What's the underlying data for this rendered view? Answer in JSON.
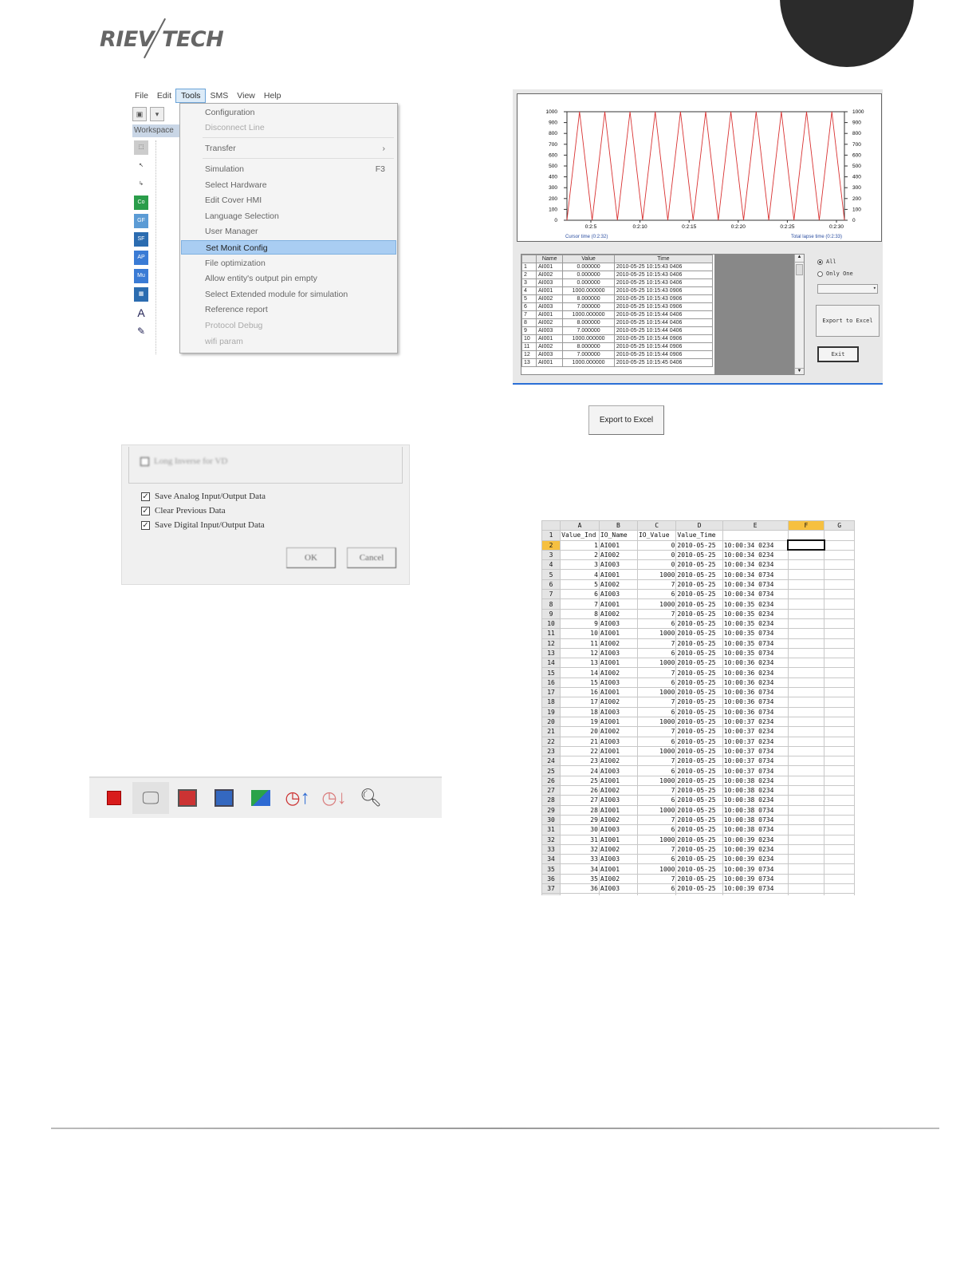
{
  "header": {
    "logo_left": "RIEV",
    "logo_right": "TECH"
  },
  "tools_menu": {
    "menubar": [
      "File",
      "Edit",
      "Tools",
      "SMS",
      "View",
      "Help"
    ],
    "active_menu": "Tools",
    "workspace_label": "Workspace",
    "items": [
      {
        "label": "Configuration",
        "state": "normal"
      },
      {
        "label": "Disconnect Line",
        "state": "disabled"
      },
      {
        "label": "Transfer",
        "state": "normal",
        "shortcut": "›"
      },
      {
        "label": "Simulation",
        "state": "normal",
        "shortcut": "F3"
      },
      {
        "label": "Select Hardware",
        "state": "normal"
      },
      {
        "label": "Edit Cover HMI",
        "state": "normal"
      },
      {
        "label": "Language Selection",
        "state": "normal"
      },
      {
        "label": "User Manager",
        "state": "normal"
      },
      {
        "label": "Set Monit Config",
        "state": "highlighted"
      },
      {
        "label": "File optimization",
        "state": "normal"
      },
      {
        "label": "Allow entity's output pin empty",
        "state": "normal"
      },
      {
        "label": "Select Extended module for simulation",
        "state": "normal"
      },
      {
        "label": "Reference report",
        "state": "normal"
      },
      {
        "label": "Protocol Debug",
        "state": "disabled"
      },
      {
        "label": "wifi param",
        "state": "disabled"
      }
    ]
  },
  "config_dialog": {
    "blurred_option": "Long Inverse for VD",
    "checkboxes": [
      {
        "label": "Save Analog Input/Output Data",
        "checked": true
      },
      {
        "label": "Clear Previous Data",
        "checked": true
      },
      {
        "label": "Save Digital Input/Output Data",
        "checked": true
      }
    ],
    "ok_label": "OK",
    "cancel_label": "Cancel"
  },
  "toolbar_icons": [
    "stop-icon",
    "monitor-icon",
    "record-icon",
    "save-icon",
    "export-icon",
    "speed-up-icon",
    "speed-down-icon",
    "zoom-icon"
  ],
  "monitor_window": {
    "cursor_time_label": "Cursor time (0:2:32)",
    "total_time_label": "Total lapse time (0:2:33)",
    "table_headers": [
      "",
      "Name",
      "Value",
      "Time"
    ],
    "table_rows": [
      [
        "1",
        "AI001",
        "0.000000",
        "2010-05-25 10:15:43 0406"
      ],
      [
        "2",
        "AI002",
        "0.000000",
        "2010-05-25 10:15:43 0406"
      ],
      [
        "3",
        "AI003",
        "0.000000",
        "2010-05-25 10:15:43 0406"
      ],
      [
        "4",
        "AI001",
        "1000.000000",
        "2010-05-25 10:15:43 0906"
      ],
      [
        "5",
        "AI002",
        "8.000000",
        "2010-05-25 10:15:43 0906"
      ],
      [
        "6",
        "AI003",
        "7.000000",
        "2010-05-25 10:15:43 0906"
      ],
      [
        "7",
        "AI001",
        "1000.000000",
        "2010-05-25 10:15:44 0406"
      ],
      [
        "8",
        "AI002",
        "8.000000",
        "2010-05-25 10:15:44 0406"
      ],
      [
        "9",
        "AI003",
        "7.000000",
        "2010-05-25 10:15:44 0406"
      ],
      [
        "10",
        "AI001",
        "1000.000000",
        "2010-05-25 10:15:44 0906"
      ],
      [
        "11",
        "AI002",
        "8.000000",
        "2010-05-25 10:15:44 0906"
      ],
      [
        "12",
        "AI003",
        "7.000000",
        "2010-05-25 10:15:44 0906"
      ],
      [
        "13",
        "AI001",
        "1000.000000",
        "2010-05-25 10:15:45 0406"
      ]
    ],
    "radio_all": "All",
    "radio_only_one": "Only One",
    "export_label": "Export to Excel",
    "exit_label": "Exit"
  },
  "chart_data": {
    "type": "line",
    "title": "",
    "xlabel": "",
    "ylabel": "",
    "ylim": [
      0,
      1000
    ],
    "y_ticks": [
      0,
      100,
      200,
      300,
      400,
      500,
      600,
      700,
      800,
      900,
      1000
    ],
    "x_tick_labels": [
      "0:2:5",
      "0:2:10",
      "0:2:15",
      "0:2:20",
      "0:2:25",
      "0:2:30"
    ],
    "series": [
      {
        "color": "#d83030",
        "values": [
          0,
          1000,
          0,
          1000,
          0,
          1000,
          0,
          1000,
          0,
          1000,
          0,
          1000,
          0,
          1000,
          0,
          1000,
          0,
          1000,
          0,
          1000,
          0,
          1000,
          0
        ]
      }
    ],
    "grid": false
  },
  "export_button": {
    "label": "Export to Excel"
  },
  "excel": {
    "columns": [
      "A",
      "B",
      "C",
      "D",
      "E",
      "F",
      "G"
    ],
    "selected_column": "F",
    "header_row": [
      "Value_Ind",
      "IO_Name",
      "IO_Value",
      "Value_Time",
      "",
      ""
    ],
    "rows": [
      [
        "1",
        "AI001",
        "0",
        "2010-05-25",
        "10:00:34",
        "0234"
      ],
      [
        "2",
        "AI002",
        "0",
        "2010-05-25",
        "10:00:34",
        "0234"
      ],
      [
        "3",
        "AI003",
        "0",
        "2010-05-25",
        "10:00:34",
        "0234"
      ],
      [
        "4",
        "AI001",
        "1000",
        "2010-05-25",
        "10:00:34",
        "0734"
      ],
      [
        "5",
        "AI002",
        "7",
        "2010-05-25",
        "10:00:34",
        "0734"
      ],
      [
        "6",
        "AI003",
        "6",
        "2010-05-25",
        "10:00:34",
        "0734"
      ],
      [
        "7",
        "AI001",
        "1000",
        "2010-05-25",
        "10:00:35",
        "0234"
      ],
      [
        "8",
        "AI002",
        "7",
        "2010-05-25",
        "10:00:35",
        "0234"
      ],
      [
        "9",
        "AI003",
        "6",
        "2010-05-25",
        "10:00:35",
        "0234"
      ],
      [
        "10",
        "AI001",
        "1000",
        "2010-05-25",
        "10:00:35",
        "0734"
      ],
      [
        "11",
        "AI002",
        "7",
        "2010-05-25",
        "10:00:35",
        "0734"
      ],
      [
        "12",
        "AI003",
        "6",
        "2010-05-25",
        "10:00:35",
        "0734"
      ],
      [
        "13",
        "AI001",
        "1000",
        "2010-05-25",
        "10:00:36",
        "0234"
      ],
      [
        "14",
        "AI002",
        "7",
        "2010-05-25",
        "10:00:36",
        "0234"
      ],
      [
        "15",
        "AI003",
        "6",
        "2010-05-25",
        "10:00:36",
        "0234"
      ],
      [
        "16",
        "AI001",
        "1000",
        "2010-05-25",
        "10:00:36",
        "0734"
      ],
      [
        "17",
        "AI002",
        "7",
        "2010-05-25",
        "10:00:36",
        "0734"
      ],
      [
        "18",
        "AI003",
        "6",
        "2010-05-25",
        "10:00:36",
        "0734"
      ],
      [
        "19",
        "AI001",
        "1000",
        "2010-05-25",
        "10:00:37",
        "0234"
      ],
      [
        "20",
        "AI002",
        "7",
        "2010-05-25",
        "10:00:37",
        "0234"
      ],
      [
        "21",
        "AI003",
        "6",
        "2010-05-25",
        "10:00:37",
        "0234"
      ],
      [
        "22",
        "AI001",
        "1000",
        "2010-05-25",
        "10:00:37",
        "0734"
      ],
      [
        "23",
        "AI002",
        "7",
        "2010-05-25",
        "10:00:37",
        "0734"
      ],
      [
        "24",
        "AI003",
        "6",
        "2010-05-25",
        "10:00:37",
        "0734"
      ],
      [
        "25",
        "AI001",
        "1000",
        "2010-05-25",
        "10:00:38",
        "0234"
      ],
      [
        "26",
        "AI002",
        "7",
        "2010-05-25",
        "10:00:38",
        "0234"
      ],
      [
        "27",
        "AI003",
        "6",
        "2010-05-25",
        "10:00:38",
        "0234"
      ],
      [
        "28",
        "AI001",
        "1000",
        "2010-05-25",
        "10:00:38",
        "0734"
      ],
      [
        "29",
        "AI002",
        "7",
        "2010-05-25",
        "10:00:38",
        "0734"
      ],
      [
        "30",
        "AI003",
        "6",
        "2010-05-25",
        "10:00:38",
        "0734"
      ],
      [
        "31",
        "AI001",
        "1000",
        "2010-05-25",
        "10:00:39",
        "0234"
      ],
      [
        "32",
        "AI002",
        "7",
        "2010-05-25",
        "10:00:39",
        "0234"
      ],
      [
        "33",
        "AI003",
        "6",
        "2010-05-25",
        "10:00:39",
        "0234"
      ],
      [
        "34",
        "AI001",
        "1000",
        "2010-05-25",
        "10:00:39",
        "0734"
      ],
      [
        "35",
        "AI002",
        "7",
        "2010-05-25",
        "10:00:39",
        "0734"
      ],
      [
        "36",
        "AI003",
        "6",
        "2010-05-25",
        "10:00:39",
        "0734"
      ]
    ]
  }
}
